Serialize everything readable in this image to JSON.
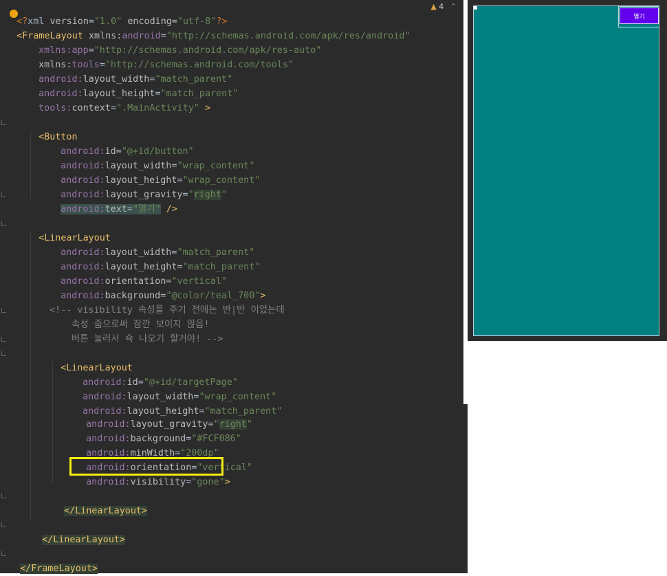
{
  "editor": {
    "warning_count": "4",
    "lines": {
      "l1": {
        "pi_open": "<?",
        "tag": "xml",
        "sp1": " ",
        "a1": "version",
        "eq1": "=",
        "v1": "\"1.0\"",
        "sp2": " ",
        "a2": "encoding",
        "eq2": "=",
        "v2": "\"utf-8\"",
        "pi_close": "?>"
      },
      "l2": {
        "tag": "<FrameLayout",
        "sp": " ",
        "ns": "xmlns:",
        "a": "android",
        "eq": "=",
        "v": "\"http://schemas.android.com/apk/res/android\""
      },
      "l3": {
        "ns": "xmlns:",
        "a": "app",
        "eq": "=",
        "v": "\"http://schemas.android.com/apk/res-auto\""
      },
      "l4": {
        "ns": "xmlns:",
        "a": "tools",
        "eq": "=",
        "v": "\"http://schemas.android.com/tools\""
      },
      "l5": {
        "ns": "android:",
        "a": "layout_width",
        "eq": "=",
        "v": "\"match_parent\""
      },
      "l6": {
        "ns": "android:",
        "a": "layout_height",
        "eq": "=",
        "v": "\"match_parent\""
      },
      "l7": {
        "ns": "tools:",
        "a": "context",
        "eq": "=",
        "v": "\".MainActivity\"",
        "end": " >"
      },
      "l8": {
        "tag": "<Button"
      },
      "l9": {
        "ns": "android:",
        "a": "id",
        "eq": "=",
        "v": "\"@+id/button\""
      },
      "l10": {
        "ns": "android:",
        "a": "layout_width",
        "eq": "=",
        "v": "\"wrap_content\""
      },
      "l11": {
        "ns": "android:",
        "a": "layout_height",
        "eq": "=",
        "v": "\"wrap_content\""
      },
      "l12": {
        "ns": "android:",
        "a": "layout_gravity",
        "eq": "=",
        "q1": "\"",
        "v": "right",
        "q2": "\""
      },
      "l13": {
        "ns": "android:",
        "a": "text",
        "eq": "=",
        "v": "\"열기\"",
        "end": " />"
      },
      "l14": {
        "tag": "<LinearLayout"
      },
      "l15": {
        "ns": "android:",
        "a": "layout_width",
        "eq": "=",
        "v": "\"match_parent\""
      },
      "l16": {
        "ns": "android:",
        "a": "layout_height",
        "eq": "=",
        "v": "\"match_parent\""
      },
      "l17": {
        "ns": "android:",
        "a": "orientation",
        "eq": "=",
        "v": "\"vertical\""
      },
      "l18": {
        "ns": "android:",
        "a": "background",
        "eq": "=",
        "v": "\"@color/teal_700\"",
        "end": ">"
      },
      "l19": {
        "text": "<!-- visibility 속성을 주기 전에는 반|반 이었는데"
      },
      "l20": {
        "text": "속성 줌으로써 잠깐 보이지 않음!"
      },
      "l21": {
        "text": "버튼 눌러서 슉 나오기 할거야! -->"
      },
      "l22": {
        "tag": "<LinearLayout"
      },
      "l23": {
        "ns": "android:",
        "a": "id",
        "eq": "=",
        "v": "\"@+id/targetPage\""
      },
      "l24": {
        "ns": "android:",
        "a": "layout_width",
        "eq": "=",
        "v": "\"wrap_content\""
      },
      "l25": {
        "ns": "android:",
        "a": "layout_height",
        "eq": "=",
        "v": "\"match_parent\""
      },
      "l26": {
        "ns": "android:",
        "a": "layout_gravity",
        "eq": "=",
        "q1": "\"",
        "v": "right",
        "q2": "\""
      },
      "l27": {
        "ns": "android:",
        "a": "background",
        "eq": "=",
        "v": "\"#FCF086\""
      },
      "l28": {
        "ns": "android:",
        "a": "minWidth",
        "eq": "=",
        "v": "\"200dp\""
      },
      "l29": {
        "ns": "android:",
        "a": "orientation",
        "eq": "=",
        "v": "\"vertical\""
      },
      "l30": {
        "ns": "android:",
        "a": "visibility",
        "eq": "=",
        "v": "\"gone\"",
        "end": ">"
      },
      "l31": {
        "tag": "</LinearLayout>"
      },
      "l32": {
        "tag": "</LinearLayout>"
      },
      "l33": {
        "tag": "</FrameLayout>"
      }
    }
  },
  "preview": {
    "button_label": "열기",
    "background_color": "#008080",
    "button_color": "#6200ee"
  },
  "colors": {
    "editor_bg": "#2b2b2b",
    "highlight_border": "#f4ec0f"
  }
}
